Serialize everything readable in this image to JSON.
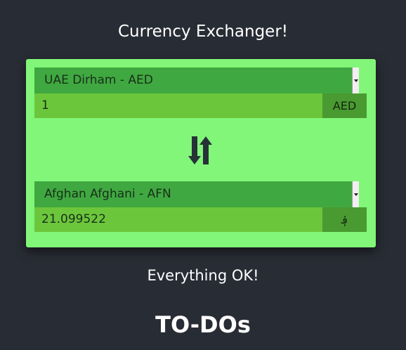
{
  "app": {
    "title": "Currency Exchanger!"
  },
  "converter": {
    "from": {
      "currency_label": "UAE Dirham - AED",
      "amount": "1",
      "symbol": "AED"
    },
    "to": {
      "currency_label": "Afghan Afghani - AFN",
      "amount": "21.099522",
      "symbol": "؋"
    },
    "swap_icon": "swap-arrows-icon"
  },
  "status": {
    "message": "Everything OK!"
  },
  "todos": {
    "heading": "TO-DOs"
  },
  "colors": {
    "background": "#282c34",
    "card": "#81f678",
    "select": "#40a840",
    "input": "#6cc63c",
    "symbol_box": "#499a31",
    "text_light": "#ffffff"
  }
}
